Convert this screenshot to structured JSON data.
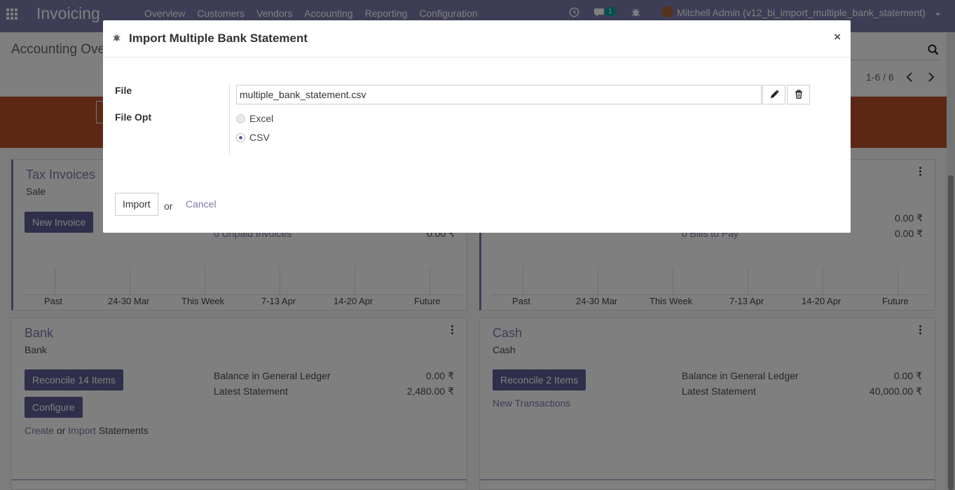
{
  "navbar": {
    "brand": "Invoicing",
    "menu": [
      "Overview",
      "Customers",
      "Vendors",
      "Accounting",
      "Reporting",
      "Configuration"
    ],
    "message_count": "1",
    "user": "Mitchell Admin (v12_bi_import_multiple_bank_statement)"
  },
  "control_panel": {
    "title": "Accounting Ove",
    "pager": "1-6 / 6"
  },
  "cards": {
    "tax_invoices": {
      "title": "Tax Invoices",
      "subtitle": "Sale",
      "button": "New Invoice",
      "unpaid_label": "0 Unpaid Invoices",
      "unpaid_value": "0.00 ₹",
      "axis": [
        "Past",
        "24-30 Mar",
        "This Week",
        "7-13 Apr",
        "14-20 Apr",
        "Future"
      ]
    },
    "vendor_bills": {
      "bills_label": "0 Bills to Pay",
      "value1": "0.00 ₹",
      "value2": "0.00 ₹",
      "axis": [
        "Past",
        "24-30 Mar",
        "This Week",
        "7-13 Apr",
        "14-20 Apr",
        "Future"
      ]
    },
    "bank": {
      "title": "Bank",
      "subtitle": "Bank",
      "reconcile_button": "Reconcile 14 Items",
      "configure_button": "Configure",
      "create_link": "Create",
      "or_text": "or",
      "import_link": "Import",
      "statements_text": "Statements",
      "balance_label": "Balance in General Ledger",
      "balance_value": "0.00 ₹",
      "latest_label": "Latest Statement",
      "latest_value": "2,480.00 ₹"
    },
    "cash": {
      "title": "Cash",
      "subtitle": "Cash",
      "reconcile_button": "Reconcile 2 Items",
      "new_transactions": "New Transactions",
      "balance_label": "Balance in General Ledger",
      "balance_value": "0.00 ₹",
      "latest_label": "Latest Statement",
      "latest_value": "40,000.00 ₹"
    }
  },
  "modal": {
    "title": "Import Multiple Bank Statement",
    "close": "×",
    "file_label": "File",
    "file_value": "multiple_bank_statement.csv",
    "file_opt_label": "File Opt",
    "options": [
      "Excel",
      "CSV"
    ],
    "selected_option": "CSV",
    "import_button": "Import",
    "or_text": "or",
    "cancel_button": "Cancel"
  }
}
